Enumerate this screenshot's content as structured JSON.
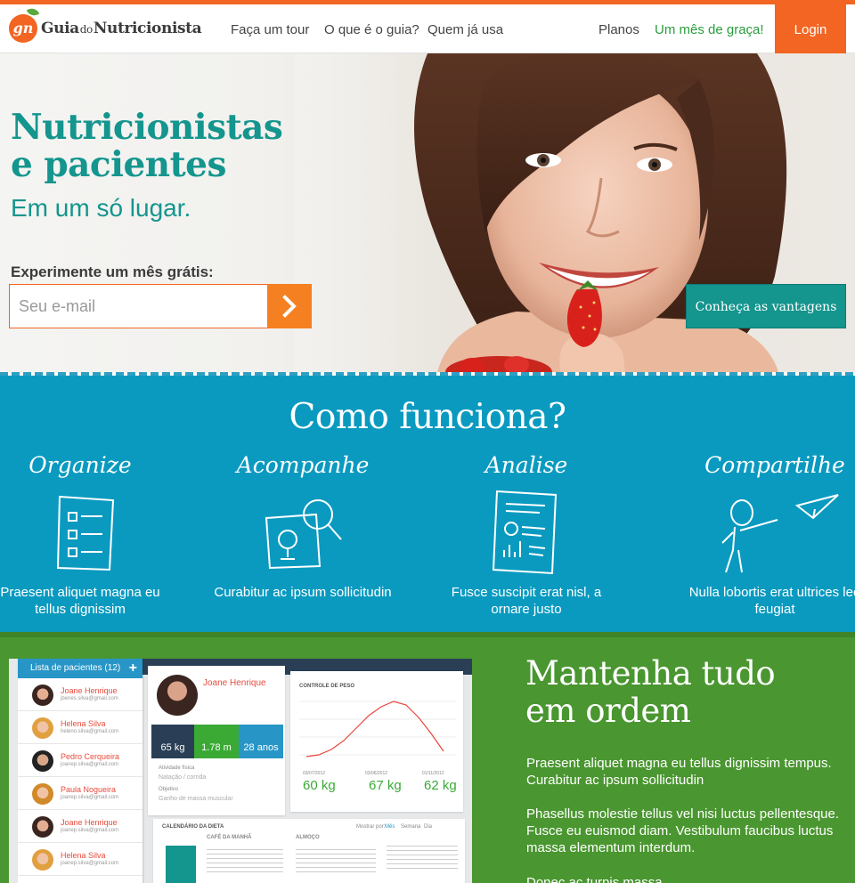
{
  "brand": {
    "logo_mark": "gn",
    "name_part1": "Guia",
    "name_part2": "do",
    "name_part3": "Nutricionista",
    "primary_color": "#f26522",
    "teal_color": "#14958e"
  },
  "nav": {
    "tour": "Faça um tour",
    "what": "O que é o guia?",
    "who": "Quem já usa",
    "plans": "Planos",
    "free_month": "Um mês de graça!",
    "login": "Login"
  },
  "hero": {
    "title_line1": "Nutricionistas",
    "title_line2": "e pacientes",
    "subtitle": "Em um só lugar.",
    "trial_label": "Experimente um mês grátis:",
    "email_placeholder": "Seu e-mail",
    "submit_icon": "chevron-right-icon",
    "advantages_button": "Conheça as vantagens"
  },
  "how": {
    "title": "Como funciona?",
    "steps": [
      {
        "name": "Organize",
        "icon": "clipboard-list-icon",
        "text": "Praesent aliquet magna eu tellus dignissim"
      },
      {
        "name": "Acompanhe",
        "icon": "magnifier-chart-icon",
        "text": "Curabitur ac ipsum sollicitudin"
      },
      {
        "name": "Analise",
        "icon": "report-document-icon",
        "text": "Fusce suscipit erat nisl, a ornare justo"
      },
      {
        "name": "Compartilhe",
        "icon": "person-paper-plane-icon",
        "text": "Nulla lobortis erat ultrices leo feugiat"
      }
    ]
  },
  "mockup": {
    "list_title": "Lista de pacientes (12)",
    "patients": [
      {
        "name": "Joane Henrique",
        "email": "jbenes.silva@gmail.com"
      },
      {
        "name": "Helena Silva",
        "email": "heleno.silva@gmail.com"
      },
      {
        "name": "Pedro Cerqueira",
        "email": "joanep.silva@gmail.com"
      },
      {
        "name": "Paula Nogueira",
        "email": "joanep.silva@gmail.com"
      },
      {
        "name": "Joane Henrique",
        "email": "joanep.silva@gmail.com"
      },
      {
        "name": "Helena Silva",
        "email": "joanep.silva@gmail.com"
      }
    ],
    "profile_name": "Joane Henrique",
    "stats": [
      "65 kg",
      "1.78 m",
      "28 anos"
    ],
    "activity_label": "Atividade física",
    "activity_value": "Natação / corrida",
    "goal_label": "Objetivo",
    "goal_value": "Ganho de massa muscular",
    "weight_chart_title": "CONTROLE DE PESO",
    "weights": [
      "60 kg",
      "67 kg",
      "62 kg"
    ],
    "weight_dates": [
      "03/07/2012",
      "03/06/2012",
      "01/11/2012"
    ],
    "diet_title": "CALENDÁRIO DA DIETA",
    "diet_cols": [
      "CAFÉ DA MANHÃ",
      "ALMOÇO"
    ],
    "view_by": "Mostrar por:",
    "view_options": [
      "Mês",
      "Semana",
      "Dia"
    ]
  },
  "order": {
    "title_line1": "Mantenha tudo",
    "title_line2": "em ordem",
    "p1": "Praesent aliquet magna eu tellus dignissim tempus. Curabitur ac ipsum sollicitudin",
    "p2": "Phasellus molestie tellus vel nisi luctus pellentesque. Fusce eu euismod diam. Vestibulum faucibus luctus massa elementum interdum.",
    "p3": "Donec ac turpis massa."
  }
}
